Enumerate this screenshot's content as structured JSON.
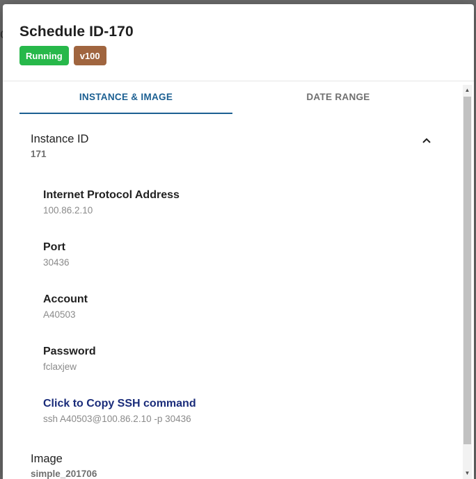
{
  "dialog": {
    "title": "Schedule ID-170",
    "badges": {
      "status": "Running",
      "version": "v100"
    }
  },
  "tabs": [
    {
      "label": "INSTANCE & IMAGE",
      "active": true
    },
    {
      "label": "DATE RANGE",
      "active": false
    }
  ],
  "instance": {
    "title": "Instance ID",
    "value": "171",
    "expanded": true,
    "chevron_icon": "chevron-up-icon"
  },
  "fields": [
    {
      "label": "Internet Protocol Address",
      "value": "100.86.2.10"
    },
    {
      "label": "Port",
      "value": "30436"
    },
    {
      "label": "Account",
      "value": "A40503"
    },
    {
      "label": "Password",
      "value": "fclaxjew"
    },
    {
      "label": "Click to Copy SSH command",
      "value": "ssh A40503@100.86.2.10 -p 30436"
    }
  ],
  "image": {
    "title": "Image",
    "value": "simple_201706"
  },
  "colors": {
    "running": "#27b84a",
    "version": "#a0653f",
    "accent": "#1b5f92",
    "link": "#1a2c7a"
  }
}
